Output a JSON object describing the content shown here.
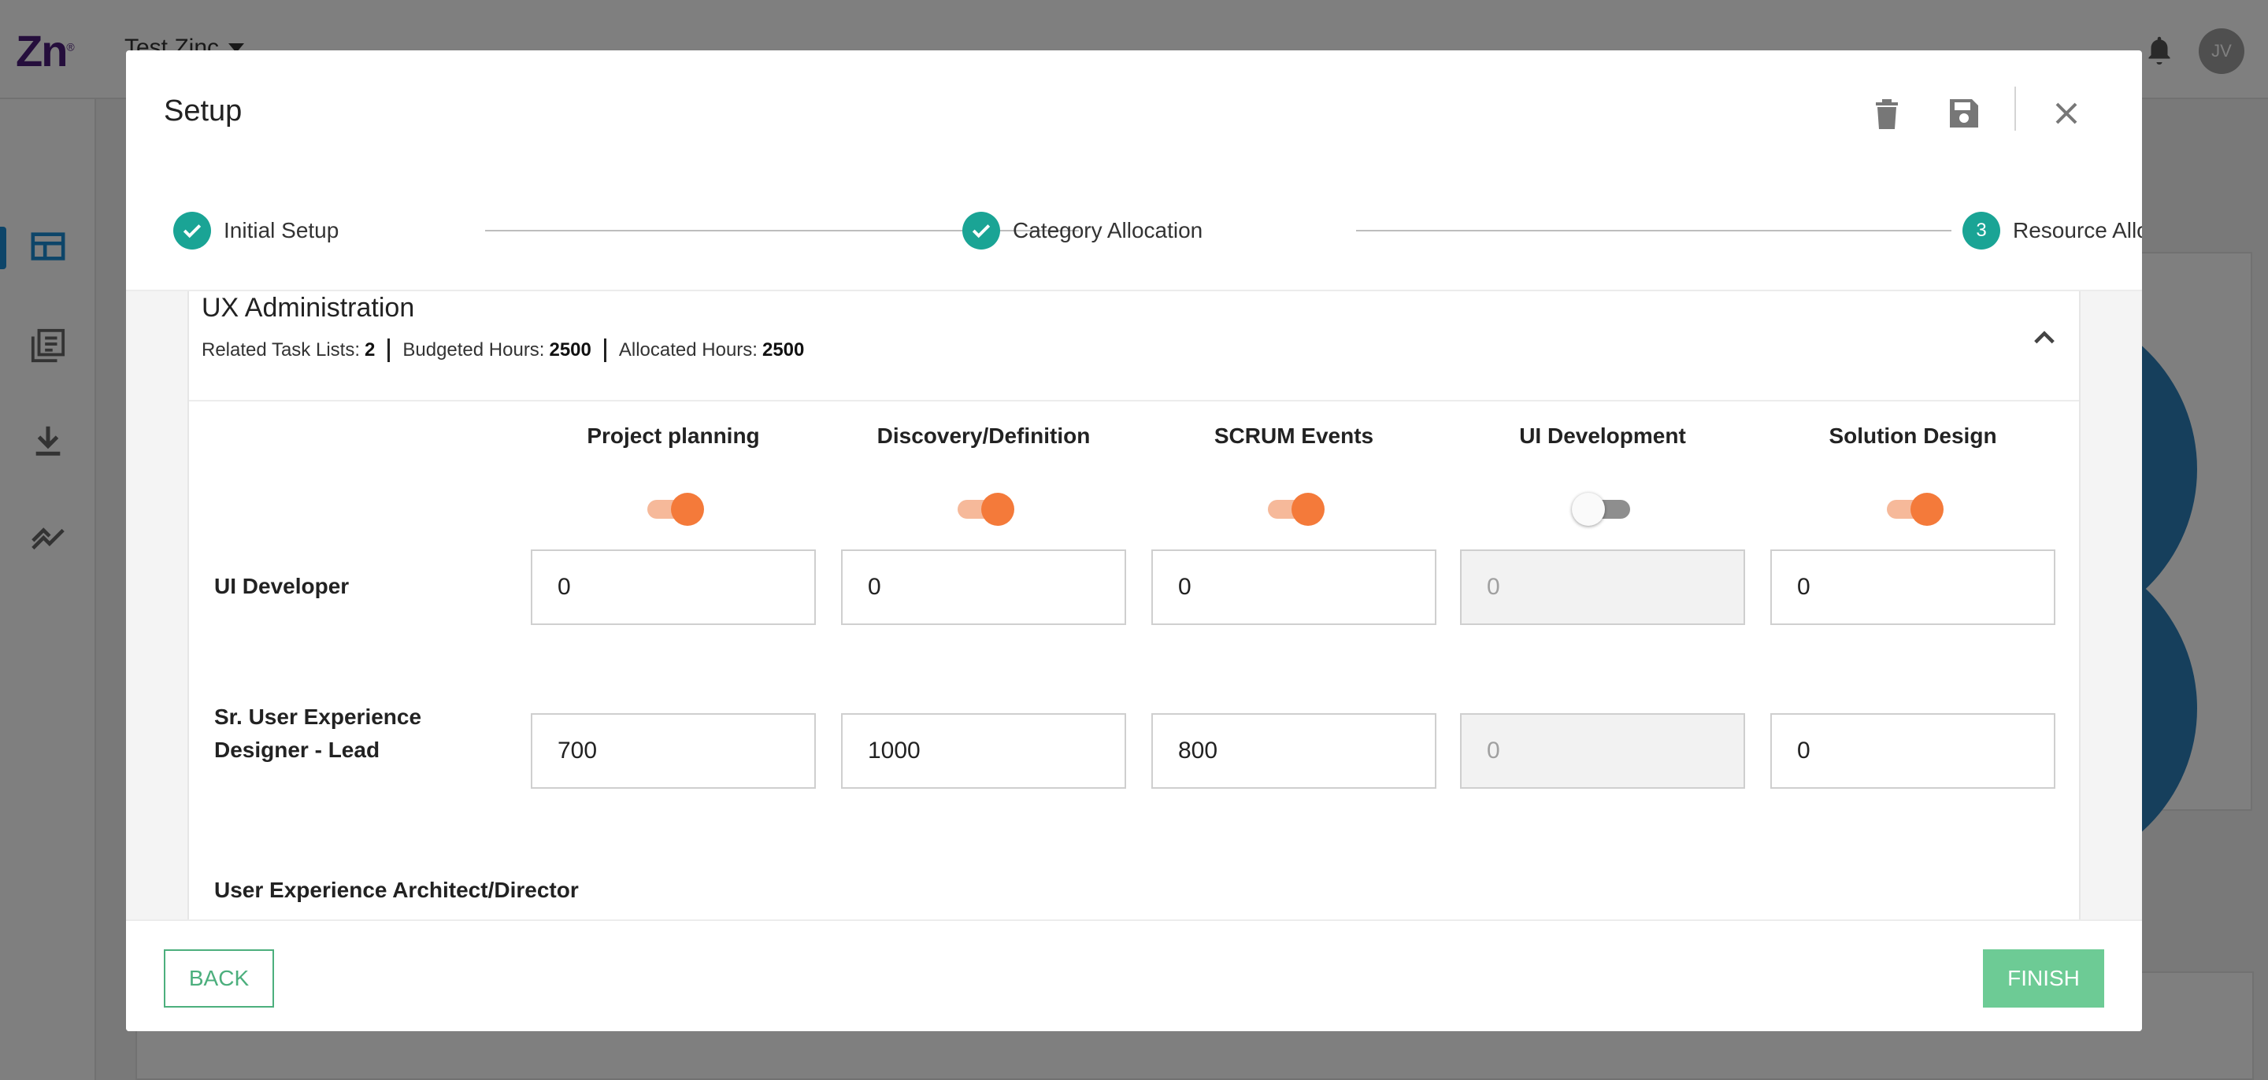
{
  "app": {
    "logo": "Zn",
    "logo_mark": "®",
    "workspace": "Test Zinc",
    "avatar_initials": "JV"
  },
  "modal": {
    "title": "Setup",
    "header_icons": [
      "trash-icon",
      "save-icon",
      "close-icon"
    ]
  },
  "stepper": {
    "steps": [
      {
        "label": "Initial Setup",
        "state": "completed"
      },
      {
        "label": "Category Allocation",
        "state": "completed"
      },
      {
        "label": "Resource Allocation",
        "state": "active",
        "number": "3"
      }
    ]
  },
  "panel": {
    "title": "UX Administration",
    "related_task_lists_label": "Related Task Lists:",
    "related_task_lists_value": "2",
    "budgeted_hours_label": "Budgeted Hours:",
    "budgeted_hours_value": "2500",
    "allocated_hours_label": "Allocated Hours:",
    "allocated_hours_value": "2500",
    "columns": [
      {
        "label": "Project planning",
        "enabled": true
      },
      {
        "label": "Discovery/Definition",
        "enabled": true
      },
      {
        "label": "SCRUM Events",
        "enabled": true
      },
      {
        "label": "UI Development",
        "enabled": false
      },
      {
        "label": "Solution Design",
        "enabled": true
      }
    ],
    "rows": [
      {
        "label": "UI Developer",
        "values": [
          "0",
          "0",
          "0",
          "0",
          "0"
        ]
      },
      {
        "label": "Sr. User Experience Designer - Lead",
        "values": [
          "700",
          "1000",
          "800",
          "0",
          "0"
        ]
      },
      {
        "label": "User Experience Architect/Director",
        "values": []
      }
    ]
  },
  "footer": {
    "back_label": "BACK",
    "finish_label": "FINISH"
  },
  "colors": {
    "teal": "#1aa495",
    "orange": "#f47a3a",
    "green": "#4caf7d",
    "logo_purple": "#4b1d78"
  }
}
